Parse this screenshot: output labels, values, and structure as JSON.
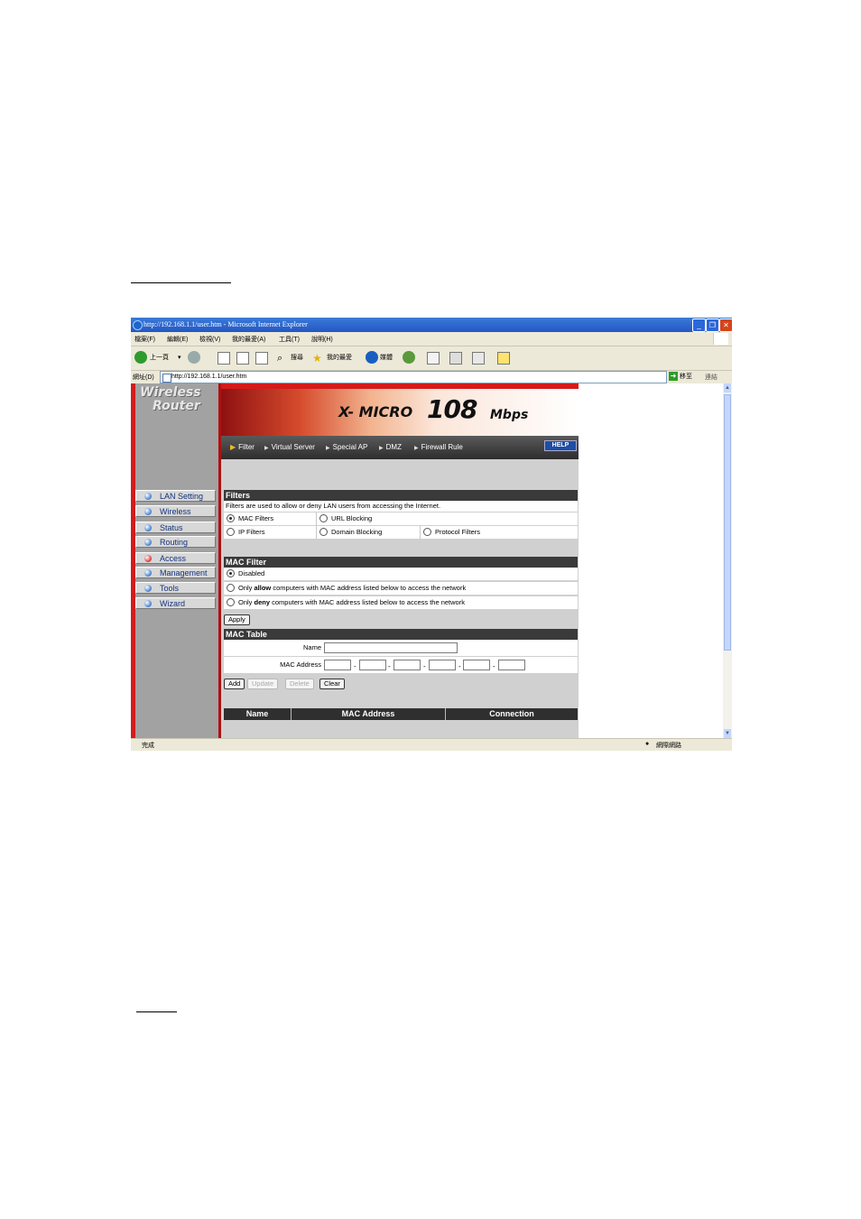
{
  "browser": {
    "title": "http://192.168.1.1/user.htm - Microsoft Internet Explorer",
    "menu": [
      "檔案(F)",
      "編輯(E)",
      "檢視(V)",
      "我的最愛(A)",
      "工具(T)",
      "說明(H)"
    ],
    "toolbar": {
      "back": "上一頁",
      "search": "搜尋",
      "favorites": "我的最愛",
      "media": "媒體"
    },
    "address_label": "網址(D)",
    "address": "http://192.168.1.1/user.htm",
    "go": "移至",
    "links": "連結",
    "status_left": "完成",
    "status_right": "網際網路"
  },
  "sidebar": {
    "logo_line1": "Wireless",
    "logo_line2": "Router",
    "items": [
      {
        "label": "LAN Setting"
      },
      {
        "label": "Wireless"
      },
      {
        "label": "Status"
      },
      {
        "label": "Routing"
      },
      {
        "label": "Access"
      },
      {
        "label": "Management"
      },
      {
        "label": "Tools"
      },
      {
        "label": "Wizard"
      }
    ]
  },
  "banner": {
    "brand": "X- MICRO",
    "speed": "108",
    "unit": "Mbps"
  },
  "tabs": [
    "Filter",
    "Virtual Server",
    "Special AP",
    "DMZ",
    "Firewall Rule"
  ],
  "help": "HELP",
  "filters": {
    "title": "Filters",
    "description": "Filters are used to allow or deny LAN users from accessing the Internet.",
    "options": [
      "MAC Filters",
      "URL Blocking",
      "IP Filters",
      "Domain Blocking",
      "Protocol Filters"
    ]
  },
  "mac_filter": {
    "title": "MAC Filter",
    "disabled": "Disabled",
    "only": "Only",
    "allow_word": "allow",
    "deny_word": "deny",
    "suffix": "computers with MAC address listed below to access the network",
    "apply": "Apply"
  },
  "mac_table": {
    "title": "MAC Table",
    "name_label": "Name",
    "mac_label": "MAC Address",
    "sep": "-",
    "buttons": {
      "add": "Add",
      "update": "Update",
      "delete": "Delete",
      "clear": "Clear"
    },
    "columns": [
      "Name",
      "MAC Address",
      "Connection"
    ]
  }
}
